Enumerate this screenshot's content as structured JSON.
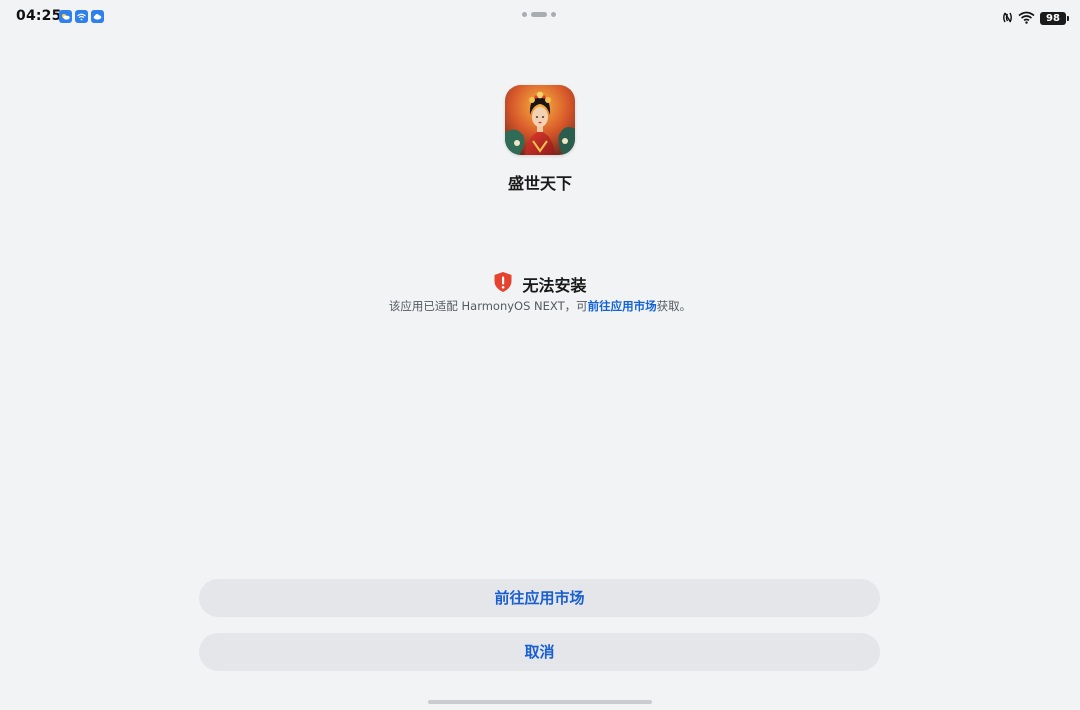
{
  "status_bar": {
    "time": "04:25",
    "notification_icons": [
      "weather-icon",
      "wifi-notification-icon",
      "cloud-icon"
    ],
    "right_icons": [
      "nfc-icon",
      "wifi-icon"
    ],
    "battery": "98"
  },
  "app": {
    "name": "盛世天下",
    "icon": "app-icon-portrait"
  },
  "install_notice": {
    "title": "无法安装",
    "desc_before": "该应用已适配 HarmonyOS NEXT，可",
    "desc_link": "前往应用市场",
    "desc_after": "获取。",
    "icon": "shield-warning-icon",
    "icon_color": "#e5432f"
  },
  "buttons": {
    "market_label": "前往应用市场",
    "cancel_label": "取消"
  },
  "colors": {
    "background": "#f1f3f5",
    "accent": "#1a5fd1",
    "button_bg": "#e4e6e9"
  }
}
